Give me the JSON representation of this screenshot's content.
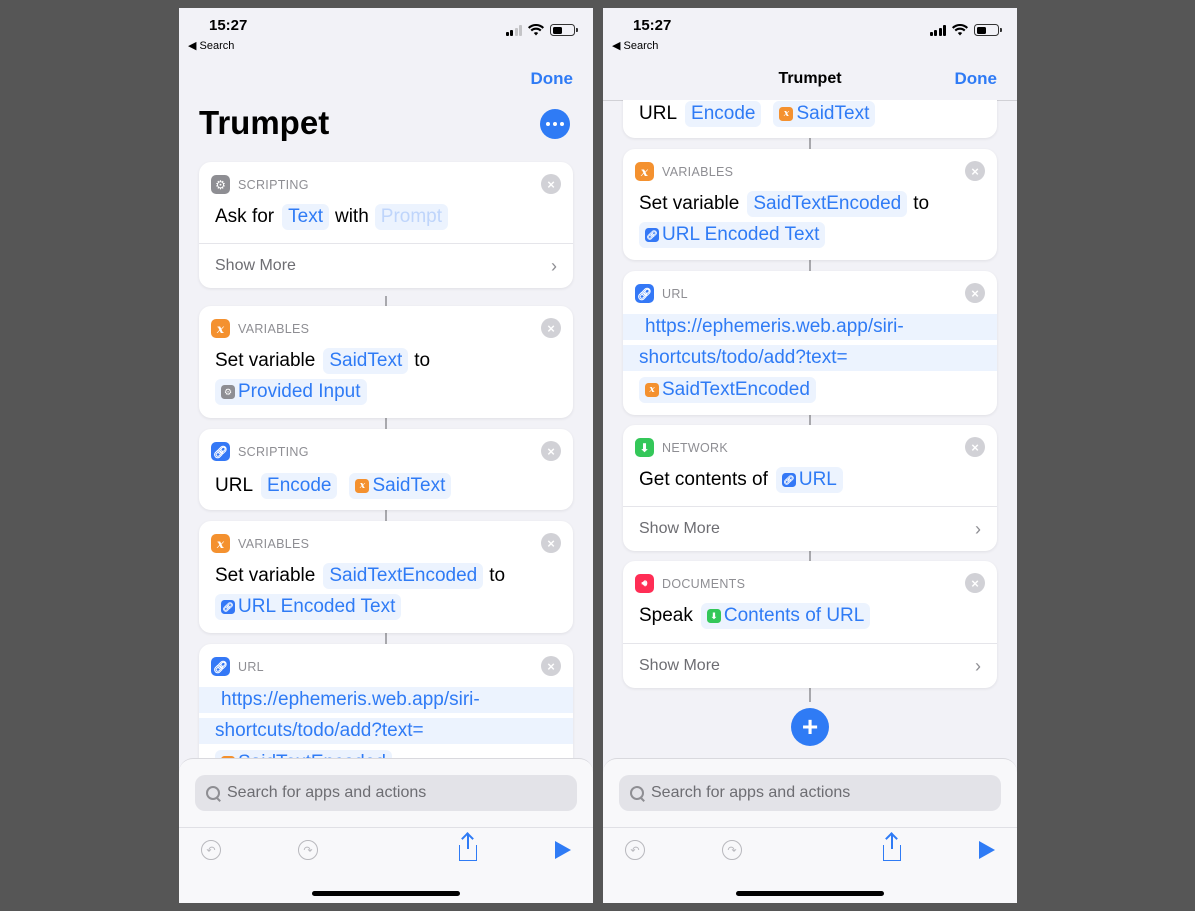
{
  "status": {
    "time": "15:27",
    "back": "◀ Search"
  },
  "nav": {
    "done": "Done",
    "title": "Trumpet"
  },
  "labels": {
    "scripting": "SCRIPTING",
    "variables": "VARIABLES",
    "url": "URL",
    "network": "NETWORK",
    "documents": "DOCUMENTS",
    "show_more": "Show More",
    "ask_for": "Ask for",
    "with": "with",
    "set_variable": "Set variable",
    "to": "to",
    "url_word": "URL",
    "get_contents_of": "Get contents of",
    "speak": "Speak"
  },
  "tokens": {
    "text": "Text",
    "prompt": "Prompt",
    "said_text": "SaidText",
    "provided_input": "Provided Input",
    "encode": "Encode",
    "said_text_encoded": "SaidTextEncoded",
    "url_encoded_text": "URL Encoded Text",
    "url": "URL",
    "contents_of_url": "Contents of URL"
  },
  "url_lines": [
    "https://ephemeris.web.app/siri-",
    "shortcuts/todo/add?text="
  ],
  "search": {
    "placeholder": "Search for apps and actions"
  },
  "colors": {
    "accent": "#2f7bf5",
    "variables": "#f4912f",
    "url": "#3478f6",
    "network": "#34c759",
    "documents": "#ff2d55"
  },
  "icons": [
    "gear-icon",
    "variable-icon",
    "link-icon",
    "download-icon",
    "speaker-icon",
    "close-icon",
    "chevron-right-icon",
    "search-icon",
    "undo-icon",
    "redo-icon",
    "share-icon",
    "play-icon",
    "plus-icon",
    "more-icon"
  ]
}
